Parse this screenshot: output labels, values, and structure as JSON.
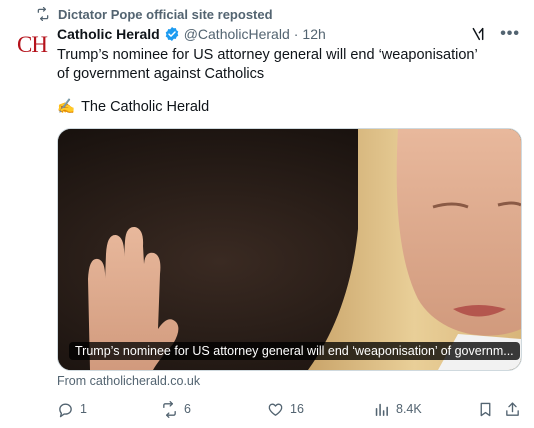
{
  "repost": {
    "icon": "repost-icon",
    "text": "Dictator Pope official site reposted"
  },
  "avatar": {
    "text": "CH",
    "color": "#b5121b"
  },
  "author": {
    "name": "Catholic Herald",
    "verified": true,
    "handle": "@CatholicHerald",
    "separator": "·",
    "time": "12h"
  },
  "tweet": {
    "text": "Trump’s nominee for US attorney general will end ‘weaponisation’ of government against Catholics",
    "byline_emoji": "✍️",
    "byline": "The Catholic Herald"
  },
  "card": {
    "caption": "Trump’s nominee for US attorney general will end ‘weaponisation’ of governm...",
    "source": "From catholicherald.co.uk"
  },
  "actions": {
    "replies": "1",
    "reposts": "6",
    "likes": "16",
    "views": "8.4K"
  },
  "colors": {
    "accent": "#1d9bf0",
    "secondary_text": "#536471",
    "primary_text": "#0f1419"
  }
}
